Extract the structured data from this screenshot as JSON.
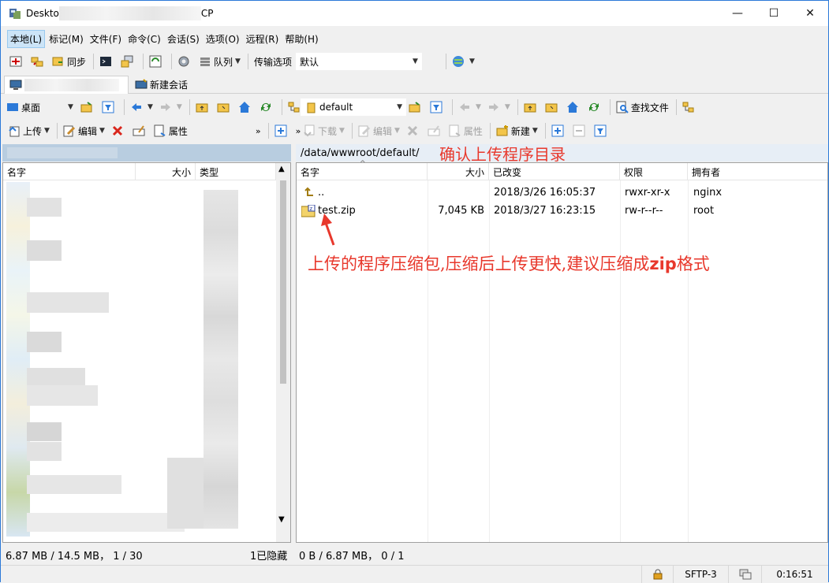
{
  "window": {
    "title_start": "Deskto",
    "title_end": "CP"
  },
  "window_controls": {
    "minimize": "—",
    "maximize": "☐",
    "close": "✕"
  },
  "menus": [
    "本地(L)",
    "标记(M)",
    "文件(F)",
    "命令(C)",
    "会话(S)",
    "选项(O)",
    "远程(R)",
    "帮助(H)"
  ],
  "toolbar": {
    "sync_label": "同步",
    "queue_label": "队列",
    "transfer_options_label": "传输选项",
    "transfer_preset": "默认"
  },
  "tabs": {
    "new_session": "新建会话"
  },
  "local": {
    "drive": "桌面",
    "upload": "上传",
    "edit": "编辑",
    "properties": "属性",
    "columns": {
      "name": "名字",
      "size": "大小",
      "type": "类型"
    },
    "status": "6.87 MB / 14.5 MB， 1 / 30",
    "hidden": "1已隐藏"
  },
  "remote": {
    "folder": "default",
    "find_files": "查找文件",
    "download": "下载",
    "edit": "编辑",
    "properties": "属性",
    "new": "新建",
    "path": "/data/wwwroot/default/",
    "columns": {
      "name": "名字",
      "size": "大小",
      "changed": "已改变",
      "rights": "权限",
      "owner": "拥有者"
    },
    "files": [
      {
        "name": "..",
        "size": "",
        "changed": "2018/3/26 16:05:37",
        "rights": "rwxr-xr-x",
        "owner": "nginx"
      },
      {
        "name": "test.zip",
        "size": "7,045 KB",
        "changed": "2018/3/27 16:23:15",
        "rights": "rw-r--r--",
        "owner": "root"
      }
    ],
    "status": "0 B / 6.87 MB， 0 / 1"
  },
  "annotations": {
    "confirm_dir": "确认上传程序目录",
    "upload_note_part1": "上传的程序压缩包,压缩后上传更快,建议压缩成",
    "upload_note_zip": "zip",
    "upload_note_part2": "格式"
  },
  "statusbar": {
    "protocol": "SFTP-3",
    "time": "0:16:51"
  },
  "colors": {
    "annotation": "#e8382c",
    "accent": "#2b79d8"
  }
}
